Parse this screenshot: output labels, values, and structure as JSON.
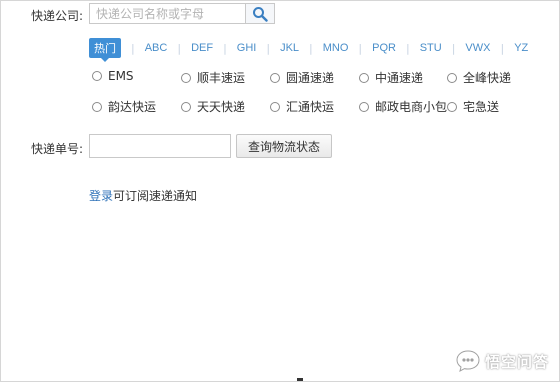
{
  "form": {
    "company_label": "快递公司:",
    "company_search_placeholder": "快递公司名称或字母",
    "tracking_label": "快递单号:",
    "tracking_value": "",
    "query_button": "查询物流状态"
  },
  "alpha_tabs": [
    "热门",
    "ABC",
    "DEF",
    "GHI",
    "JKL",
    "MNO",
    "PQR",
    "STU",
    "VWX",
    "YZ"
  ],
  "active_tab": "热门",
  "couriers": [
    [
      "EMS",
      "顺丰速运",
      "圆通速递",
      "中通速递",
      "全峰快递"
    ],
    [
      "韵达快运",
      "天天快递",
      "汇通快运",
      "邮政电商小包",
      "宅急送"
    ]
  ],
  "login": {
    "link": "登录",
    "suffix": "可订阅速递通知"
  },
  "watermark": "悟空问答",
  "icons": {
    "search": "search-icon",
    "watermark_logo": "chat-bubble-icon"
  },
  "colors": {
    "accent": "#3f8fd6",
    "tab_text": "#4a8ec9",
    "link": "#2f72b8"
  }
}
